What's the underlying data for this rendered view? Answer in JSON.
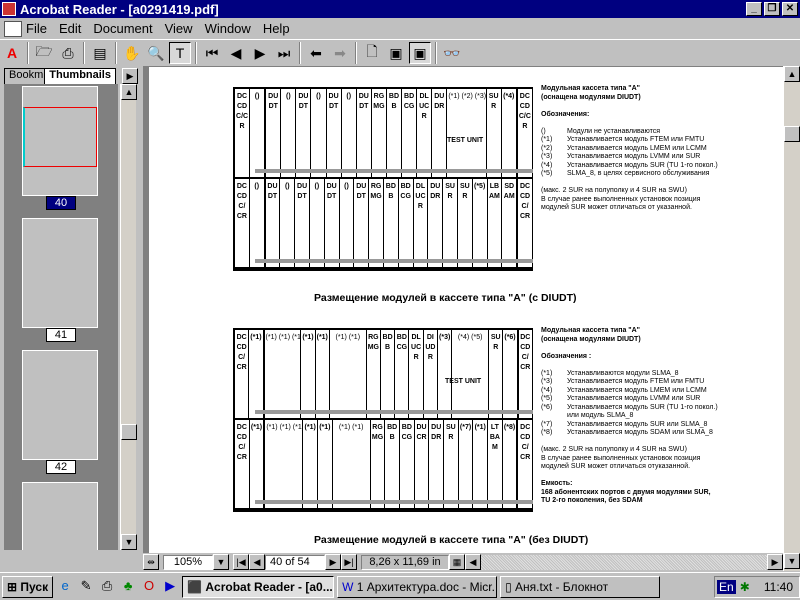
{
  "window": {
    "title": "Acrobat Reader - [a0291419.pdf]"
  },
  "menu": [
    "File",
    "Edit",
    "Document",
    "View",
    "Window",
    "Help"
  ],
  "panel": {
    "tabs": [
      "Bookm",
      "Thumbnails"
    ],
    "thumbnails": [
      {
        "label": "40",
        "selected": true
      },
      {
        "label": "41"
      },
      {
        "label": "42"
      }
    ]
  },
  "rack1": {
    "top": [
      "DCCDC/CR",
      "()",
      "DUDT",
      "()",
      "DUDT",
      "()",
      "DUDT",
      "()",
      "DUDT",
      "RGMG",
      "BDB",
      "BDCG",
      "DLUCR",
      "DUDR",
      "(*1) (*2) (*3)",
      "SUR",
      "(*4)",
      "DCCDC/CR"
    ],
    "bottom": [
      "DCCDC/CR",
      "()",
      "DUDT",
      "()",
      "DUDT",
      "()",
      "DUDT",
      "()",
      "DUDT",
      "RGMG",
      "BDB",
      "BDCG",
      "DLUCR",
      "DUDR",
      "SUR",
      "SUR",
      "(*5)",
      "LBAM",
      "SDAM",
      "DCCDC/CR"
    ],
    "test_unit": "TEST UNIT"
  },
  "notes1": {
    "title1": "Модульная кассета типа \"A\"",
    "title2": "(оснащена модулями DIUDT)",
    "legend_title": "Обозначения:",
    "items": [
      [
        "()",
        "Модули не устанавливаются"
      ],
      [
        "(*1)",
        "Устанавливается модуль FTEM или FMTU"
      ],
      [
        "(*2)",
        "Устанавливается модуль LMEM или LCMM"
      ],
      [
        "(*3)",
        "Устанавливается модуль LVMM или SUR"
      ],
      [
        "(*4)",
        "Устанавливается модуль SUR (TU 1-го покол.)"
      ],
      [
        "(*5)",
        "SLMA_8, в целях сервисного обслуживания"
      ]
    ],
    "max": "(макс. 2 SUR на полуполку и 4 SUR на SWU)",
    "remark": "В случае ранее выполненных установок позиция модулей SUR может отличаться от указанной."
  },
  "caption1": "Размещение модулей в кассете типа \"A\" (с DIUDT)",
  "rack2": {
    "top": [
      "DCCDC/CR",
      "(*1)",
      "(*1) (*1) (*1)",
      "(*1)",
      "(*1)",
      "(*1) (*1)",
      "RGMG",
      "BDB",
      "BDCG",
      "DLUCR",
      "DIUDR",
      "(*3)",
      "(*4) (*5)",
      "SUR",
      "(*6)",
      "DCCDC/CR"
    ],
    "bottom": [
      "DCCDC/CR",
      "(*1)",
      "(*1) (*1) (*1)",
      "(*1)",
      "(*1)",
      "(*1) (*1)",
      "RGMG",
      "BDB",
      "BDCG",
      "DUCR",
      "DUDR",
      "SUR",
      "(*7)",
      "(*1)",
      "LTBAM",
      "(*8)",
      "DCCDC/CR"
    ],
    "test_unit": "TEST UNIT"
  },
  "notes2": {
    "title1": "Модульная кассета типа \"A\"",
    "title2": "(оснащена модулями DIUDT)",
    "legend_title": "Обозначения :",
    "items": [
      [
        "(*1)",
        "Устанавливаются модули  SLMA_8"
      ],
      [
        "(*3)",
        "Устанавливается модуль FTEM или FMTU"
      ],
      [
        "(*4)",
        "Устанавливается модуль LMEM или LCMM"
      ],
      [
        "(*5)",
        "Устанавливается модуль LVMM или SUR"
      ],
      [
        "(*6)",
        "Устанавливается модуль SUR (TU 1-го покол.) или модуль SLMA_8"
      ],
      [
        "(*7)",
        "Устанавливается модуль SUR или SLMA_8"
      ],
      [
        "(*8)",
        "Устанавливается модуль SDAM или SLMA_8"
      ]
    ],
    "max": "(макс. 2 SUR на полуполку и 4 SUR на SWU)",
    "remark": "В случае ранее выполненных установок позиция модулей SUR может отличаться отуказанной.",
    "capacity_title": "Емкость:",
    "capacity": "168 абонентских портов с двумя модулями SUR, TU 2-го поколения, без SDAM"
  },
  "caption2": "Размещение модулей в кассете типа \"A\" (без DIUDT)",
  "status": {
    "zoom": "105%",
    "page": "40 of 54",
    "size": "8,26 x 11,69 in"
  },
  "taskbar": {
    "start": "Пуск",
    "tasks": [
      "Acrobat Reader - [a0...",
      "1 Архитектура.doc - Micr...",
      "Аня.txt - Блокнот"
    ],
    "lang": "En",
    "clock": "11:40"
  }
}
